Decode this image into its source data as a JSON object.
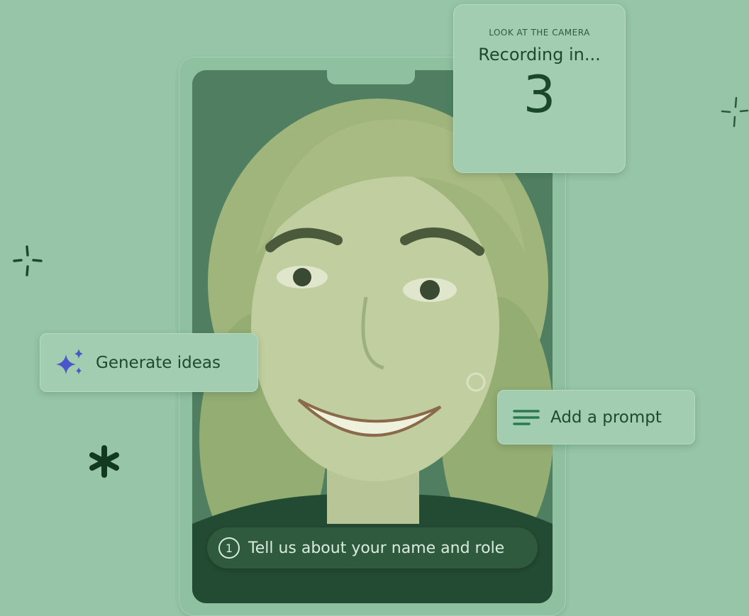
{
  "recording_card": {
    "eyebrow": "LOOK AT THE CAMERA",
    "title": "Recording in...",
    "countdown": "3"
  },
  "generate_chip": {
    "label": "Generate ideas",
    "icon": "sparkle-icon"
  },
  "prompt_chip": {
    "label": "Add a prompt",
    "icon": "lines-icon"
  },
  "question_pill": {
    "number": "1",
    "text": "Tell us about your name and role"
  },
  "colors": {
    "background": "#97c5a7",
    "sparkle_accent": "#4a56c9",
    "text_dark": "#1e4a30"
  }
}
